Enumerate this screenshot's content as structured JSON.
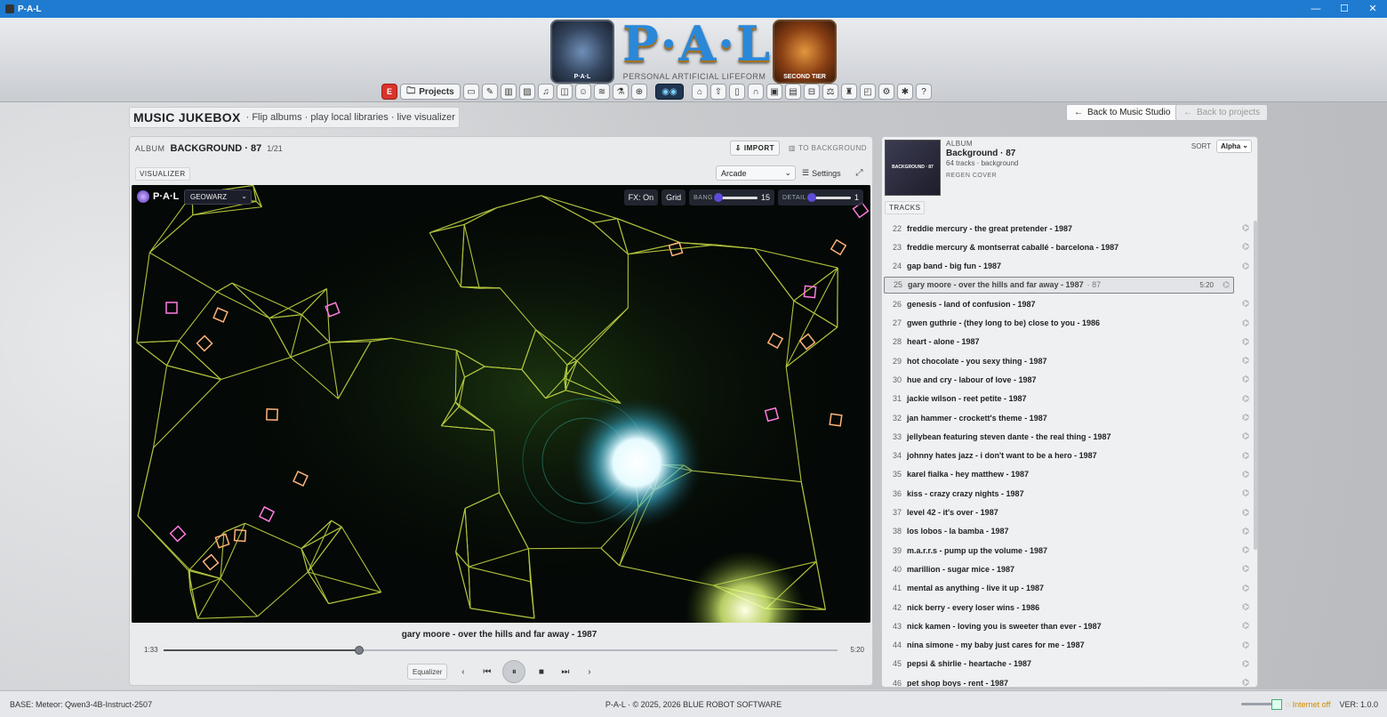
{
  "window": {
    "title": "P-A-L",
    "min": "—",
    "max": "☐",
    "close": "✕"
  },
  "header": {
    "logo_text": "P·A·L",
    "logo_subtitle": "PERSONAL ARTIFICIAL LIFEFORM",
    "badge_left_caption": "P·A·L",
    "badge_right_caption": "SECOND TIER",
    "projects_label": "Projects",
    "e_label": "E"
  },
  "page": {
    "title": "MUSIC JUKEBOX",
    "subtitle": "Flip albums · play local libraries · live visualizer",
    "back_studio": "Back to Music Studio",
    "back_projects": "Back to projects"
  },
  "album_bar": {
    "key": "ALBUM",
    "name": "BACKGROUND · 87",
    "position": "1/21",
    "import": "IMPORT",
    "to_background": "TO BACKGROUND"
  },
  "visualizer": {
    "label": "VISUALIZER",
    "mode": "Arcade",
    "settings": "Settings",
    "logo": "P·A·L",
    "game": "GEOWARZ",
    "fx": "FX: On",
    "grid": "Grid",
    "bang_label": "BANG",
    "bang_value": "15",
    "bang_level": 0.05,
    "detail_label": "DETAIL",
    "detail_value": "1",
    "detail_level": 0.05
  },
  "player": {
    "now_playing": "gary moore - over the hills and far away - 1987",
    "elapsed": "1:33",
    "total": "5:20",
    "progress": 0.29,
    "equalizer": "Equalizer"
  },
  "album_panel": {
    "key": "ALBUM",
    "title": "Background · 87",
    "meta": "64 tracks · background",
    "regen": "REGEN COVER",
    "cover_text": "BACKGROUND · 87",
    "sort_label": "SORT",
    "sort_value": "Alpha",
    "tracks_label": "TRACKS"
  },
  "tracks": [
    {
      "n": "22",
      "title": "freddie mercury - the great pretender - 1987"
    },
    {
      "n": "23",
      "title": "freddie mercury & montserrat caballé - barcelona - 1987"
    },
    {
      "n": "24",
      "title": "gap band - big fun - 1987"
    },
    {
      "n": "25",
      "title": "gary moore - over the hills and far away - 1987",
      "extra": "· 87",
      "dur": "5:20",
      "selected": true
    },
    {
      "n": "26",
      "title": "genesis - land of confusion - 1987"
    },
    {
      "n": "27",
      "title": "gwen guthrie - (they long to be) close to you - 1986"
    },
    {
      "n": "28",
      "title": "heart - alone - 1987"
    },
    {
      "n": "29",
      "title": "hot chocolate - you sexy thing - 1987"
    },
    {
      "n": "30",
      "title": "hue and cry - labour of love - 1987"
    },
    {
      "n": "31",
      "title": "jackie wilson - reet petite - 1987"
    },
    {
      "n": "32",
      "title": "jan hammer - crockett's theme - 1987"
    },
    {
      "n": "33",
      "title": "jellybean featuring steven dante - the real thing - 1987"
    },
    {
      "n": "34",
      "title": "johnny hates jazz - i don't want to be a hero - 1987"
    },
    {
      "n": "35",
      "title": "karel fialka - hey matthew - 1987"
    },
    {
      "n": "36",
      "title": "kiss - crazy crazy nights - 1987"
    },
    {
      "n": "37",
      "title": "level 42 - it's over - 1987"
    },
    {
      "n": "38",
      "title": "los lobos - la bamba - 1987"
    },
    {
      "n": "39",
      "title": "m.a.r.r.s - pump up the volume - 1987"
    },
    {
      "n": "40",
      "title": "marillion - sugar mice - 1987"
    },
    {
      "n": "41",
      "title": "mental as anything - live it up - 1987"
    },
    {
      "n": "42",
      "title": "nick berry - every loser wins - 1986"
    },
    {
      "n": "43",
      "title": "nick kamen - loving you is sweeter than ever - 1987"
    },
    {
      "n": "44",
      "title": "nina simone - my baby just cares for me - 1987"
    },
    {
      "n": "45",
      "title": "pepsi & shirlie - heartache - 1987"
    },
    {
      "n": "46",
      "title": "pet shop boys - rent - 1987"
    }
  ],
  "status": {
    "base": "BASE: Meteor: Qwen3-4B-Instruct-2507",
    "center": "P-A-L · © 2025, 2026 BLUE ROBOT SOFTWARE",
    "internet": "Internet off",
    "version": "VER: 1.0.0"
  },
  "icons": {
    "toolbar_left": [
      "chat-icon",
      "pen-icon",
      "book-icon",
      "image-icon",
      "music-icon",
      "game-icon",
      "robot-icon",
      "audio-icon",
      "flask-icon",
      "globe-icon"
    ],
    "toolbar_right": [
      "home-icon",
      "upload-icon",
      "document-icon",
      "headphones-icon",
      "chip-icon",
      "archive-icon",
      "drive-icon",
      "scale-icon",
      "trophy-icon",
      "map-icon",
      "settings-icon",
      "bug-icon",
      "help-icon"
    ]
  }
}
